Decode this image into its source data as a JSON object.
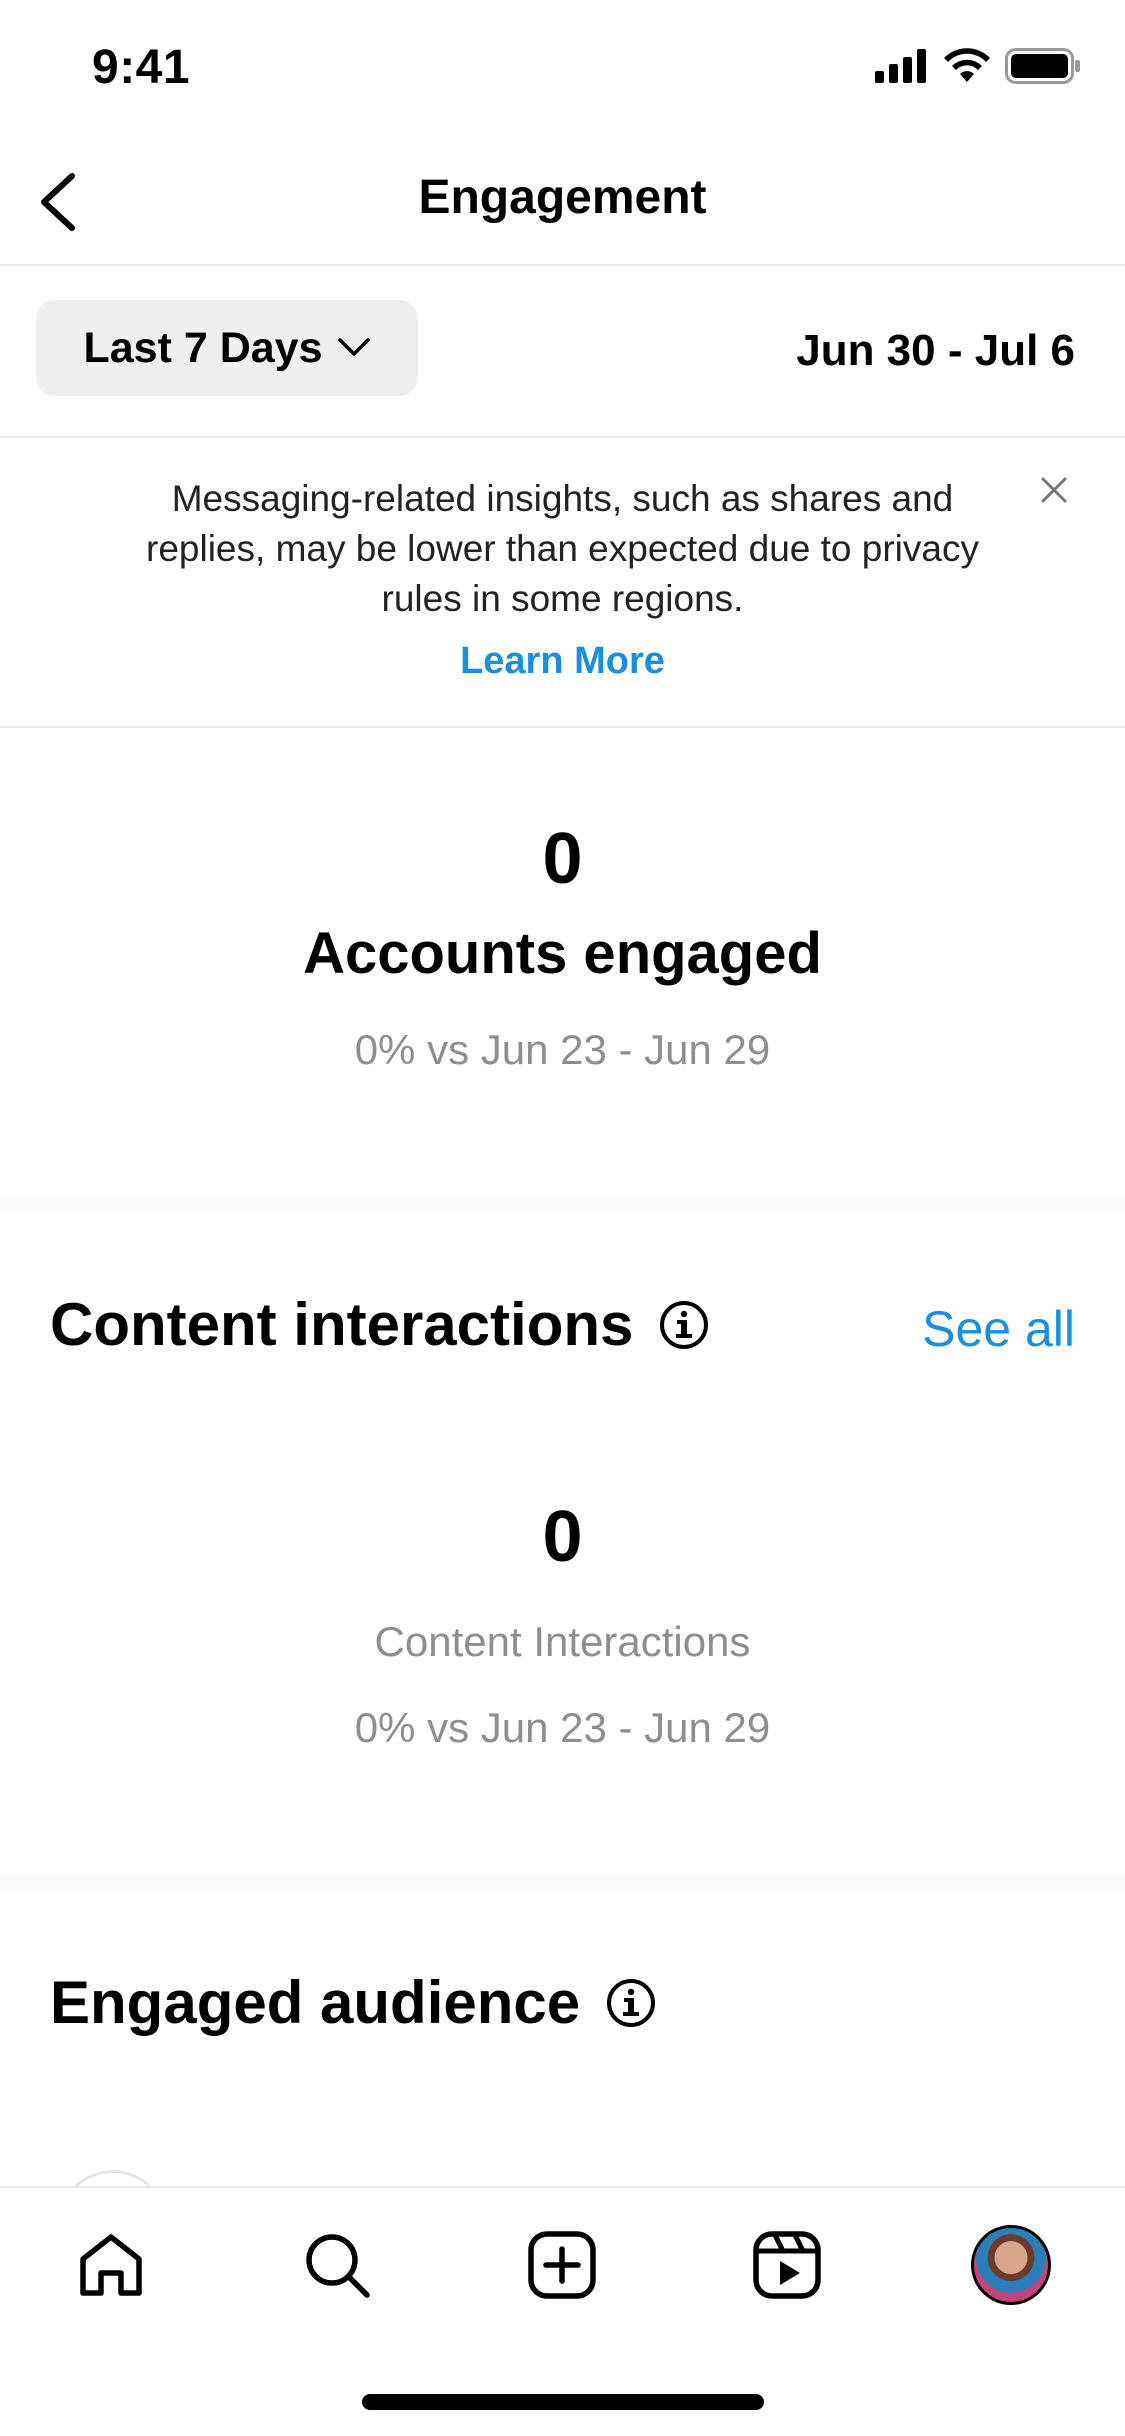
{
  "status_bar": {
    "time": "9:41"
  },
  "nav": {
    "title": "Engagement"
  },
  "filter": {
    "period_label": "Last 7 Days",
    "date_range": "Jun 30 - Jul 6"
  },
  "notice": {
    "text": "Messaging-related insights, such as shares and replies, may be lower than expected due to privacy rules in some regions.",
    "link": "Learn More"
  },
  "accounts_engaged": {
    "value": "0",
    "label": "Accounts engaged",
    "comparison": "0% vs Jun 23 - Jun 29"
  },
  "content_interactions": {
    "title": "Content interactions",
    "see_all": "See all",
    "value": "0",
    "label": "Content Interactions",
    "comparison": "0% vs Jun 23 - Jun 29"
  },
  "engaged_audience": {
    "title": "Engaged audience"
  },
  "tab_bar": {
    "items": [
      {
        "icon": "home-icon"
      },
      {
        "icon": "search-icon"
      },
      {
        "icon": "create-icon"
      },
      {
        "icon": "reels-icon"
      },
      {
        "icon": "profile-avatar"
      }
    ]
  },
  "colors": {
    "link": "#1a8fe0",
    "secondary_text": "#8e8e8e",
    "chip_bg": "#efefef"
  }
}
